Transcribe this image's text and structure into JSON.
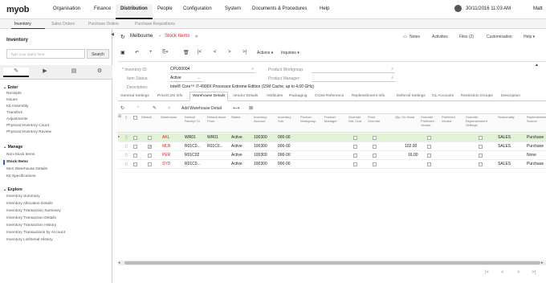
{
  "topbar": {
    "logo": "myob",
    "menu": [
      "Organisation",
      "Finance",
      "Distribution",
      "People",
      "Configuration",
      "System",
      "Documents & Procedures",
      "Help"
    ],
    "active_menu": "Distribution",
    "datetime": "30/11/2016  11:03 AM",
    "user": "Matt"
  },
  "subnav": [
    "Inventory",
    "Sales Orders",
    "Purchase Orders",
    "Purchase Requisitions"
  ],
  "sidebar": {
    "title": "Inventory",
    "search_placeholder": "Type your query here",
    "search_button": "Search",
    "enter_label": "Enter",
    "enter_items": [
      "Receipts",
      "Issues",
      "Kit Assembly",
      "Transfers",
      "Adjustments",
      "Physical Inventory Count",
      "Physical Inventory Review"
    ],
    "manage_label": "Manage",
    "manage_items": [
      "Non-Stock Items",
      "Stock Items",
      "Item Warehouse Details",
      "Kit Specifications"
    ],
    "explore_label": "Explore",
    "explore_items": [
      "Inventory Summary",
      "Inventory Allocation Details",
      "Inventory Transaction Summary",
      "Inventory Transaction Details",
      "Inventory Transaction History",
      "Inventory Transactions by Account",
      "Inventory Lot/Serial History"
    ]
  },
  "header": {
    "company": "Melbourne",
    "separator": "-",
    "screen": "Stock Items",
    "right": [
      "Notes",
      "Activities",
      "Files (2)",
      "Customisation",
      "Help"
    ]
  },
  "toolbar": {
    "actions": "Actions",
    "inquiries": "Inquiries"
  },
  "form": {
    "inventory_id_label": "Inventory ID:",
    "inventory_id": "CPU00004",
    "item_status_label": "Item Status:",
    "item_status": "Active",
    "description_label": "Description:",
    "description": "Intel® Core™ i7-4900X Processor Extreme Edition (15M Cache, up to 4.00 GHz)",
    "workgroup_label": "Product Workgroup:",
    "workgroup": "",
    "manager_label": "Product Manager:",
    "manager": ""
  },
  "tabs": [
    "General Settings",
    "Price/Cost Info",
    "Warehouse Details",
    "Vendor Details",
    "Attributes",
    "Packaging",
    "Cross-Reference",
    "Replenishment Info",
    "Deferral Settings",
    "GL Accounts",
    "Restriction Groups",
    "Description"
  ],
  "active_tab": "Warehouse Details",
  "grid": {
    "add_label": "Add Warehouse Detail",
    "columns": {
      "default": "Default",
      "warehouse": "Warehouse",
      "receipt": "Default Receipt To",
      "issue": "Default Issue From",
      "status": "Status",
      "account": "Inventory Account",
      "sub": "Inventory Sub",
      "workgroup": "Product Workgroup",
      "manager": "Product Manager",
      "override_std": "Override Std. Cost",
      "override_price": "Price Override",
      "qty": "Qty. On Hand",
      "override_vendor": "Override Preferred Vendor",
      "pref_vendor": "Preferred Vendor",
      "override_repl": "Override Replenishment Settings",
      "seasonality": "Seasonality",
      "source": "Replenishment Source"
    },
    "rows": [
      {
        "default": false,
        "warehouse": "AKL",
        "receipt": "WR01",
        "issue": "WR01",
        "status": "Active",
        "account": "100300",
        "sub": "000-00",
        "qty": "",
        "seasonality": "SALES",
        "source": "Purchase"
      },
      {
        "default": true,
        "warehouse": "MLB",
        "receipt": "R01C0...",
        "issue": "R01C0...",
        "status": "Active",
        "account": "100300",
        "sub": "000-00",
        "qty": "102.00",
        "seasonality": "SALES",
        "source": "Purchase"
      },
      {
        "default": false,
        "warehouse": "PER",
        "receipt": "R01C02",
        "issue": "",
        "status": "Active",
        "account": "100300",
        "sub": "000-00",
        "qty": "16.00",
        "seasonality": "",
        "source": "None"
      },
      {
        "default": false,
        "warehouse": "SYD",
        "receipt": "R01C0...",
        "issue": "",
        "status": "Active",
        "account": "100300",
        "sub": "000-00",
        "qty": "",
        "seasonality": "SALES",
        "source": "Purchase"
      }
    ]
  },
  "colors": {
    "brand": "#e2231a",
    "selected_row": "#e2f2d6",
    "active_nav": "#2a66c9"
  }
}
